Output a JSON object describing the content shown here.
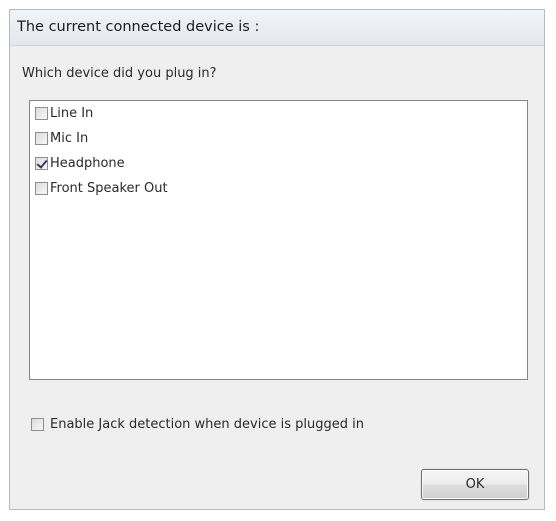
{
  "dialog": {
    "title": "The current connected device is :",
    "question": "Which device did you plug in?",
    "devices": [
      {
        "label": "Line In",
        "checked": false
      },
      {
        "label": "Mic In",
        "checked": false
      },
      {
        "label": "Headphone",
        "checked": true
      },
      {
        "label": "Front Speaker Out",
        "checked": false
      }
    ],
    "jack_detection": {
      "label": "Enable Jack detection when device is plugged in",
      "checked": false
    },
    "ok_label": "OK"
  },
  "colors": {
    "dialog_background": "#efefef",
    "titlebar_background": "#e3e8ee",
    "list_background": "#ffffff",
    "check_mark": "#2f3e5c"
  },
  "icons": [
    "checkbox-icon",
    "checkmark-icon"
  ]
}
